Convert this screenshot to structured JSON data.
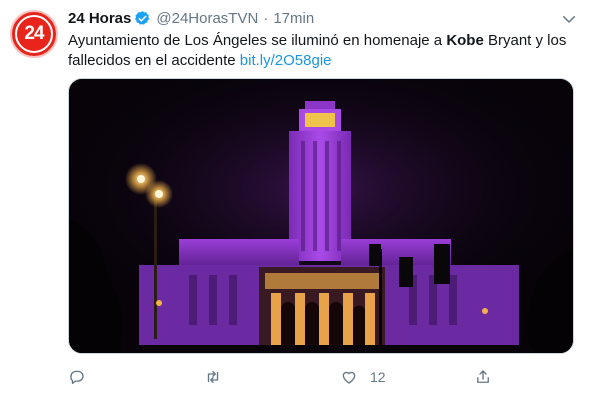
{
  "tweet": {
    "display_name": "24 Horas",
    "handle": "@24HorasTVN",
    "separator": "·",
    "time": "17min",
    "avatar_text": "24",
    "text_before": "Ayuntamiento de Los Ángeles se iluminó en homenaje a ",
    "text_bold": "Kobe",
    "text_after": " Bryant y los fallecidos en el accidente ",
    "link": "bit.ly/2O58gie",
    "likes": "12"
  },
  "colors": {
    "brand_red": "#e8241b",
    "verified_blue": "#1da1f2",
    "link_blue": "#1b95e0",
    "muted_gray": "#657786",
    "night_lighting": "#9b3bd6",
    "warm_light": "#f3b24a"
  },
  "icons": {
    "verified": "verified-badge-icon",
    "caret": "chevron-down-icon",
    "reply": "reply-icon",
    "retweet": "retweet-icon",
    "like": "heart-icon",
    "share": "share-icon"
  }
}
